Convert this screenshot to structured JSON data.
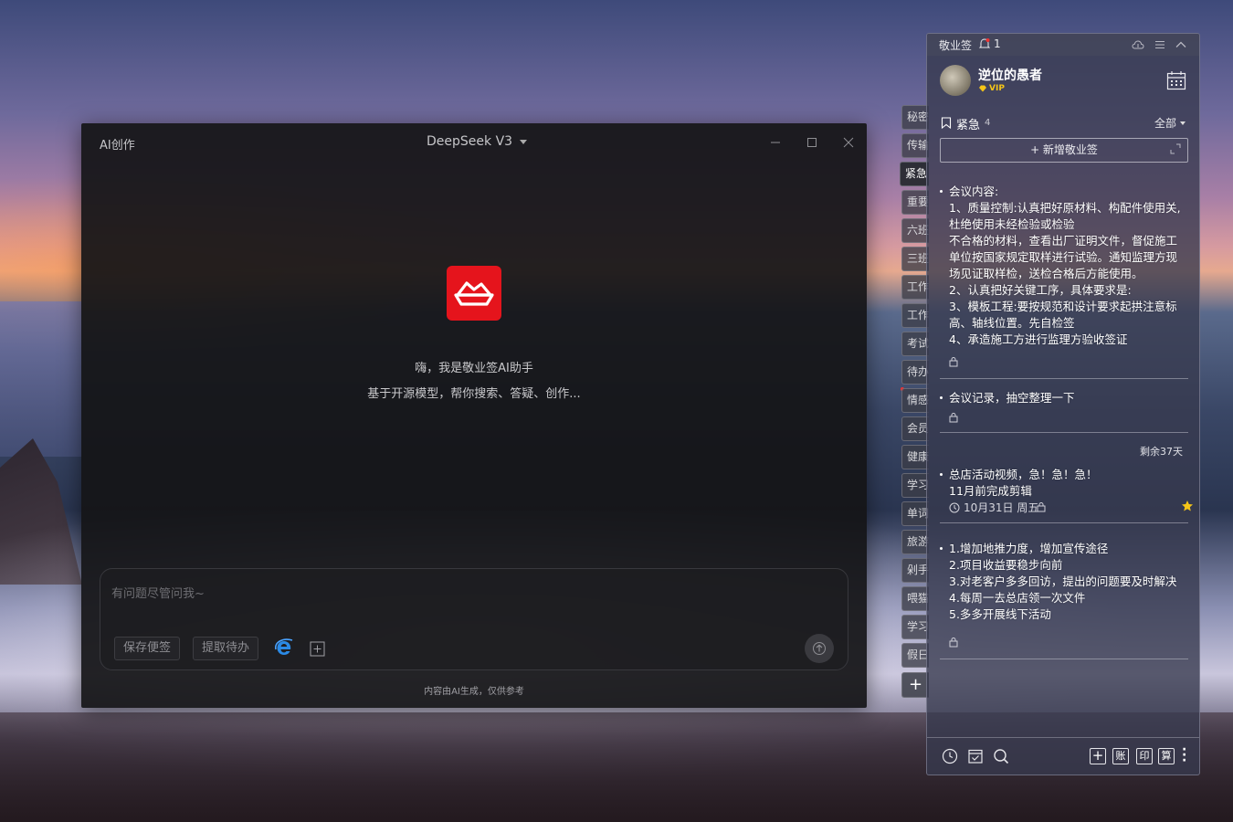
{
  "ai_window": {
    "title": "AI创作",
    "model": "DeepSeek V3",
    "greeting_line1": "嗨，我是敬业签AI助手",
    "greeting_line2": "基于开源模型，帮你搜索、答疑、创作...",
    "input_placeholder": "有问题尽管问我~",
    "save_note_label": "保存便签",
    "extract_todo_label": "提取待办",
    "disclaimer": "内容由AI生成，仅供参考",
    "brand_color": "#e5141c"
  },
  "category_tabs": [
    {
      "label": "秘密"
    },
    {
      "label": "传输"
    },
    {
      "label": "紧急",
      "active": true
    },
    {
      "label": "重要"
    },
    {
      "label": "六班"
    },
    {
      "label": "三班"
    },
    {
      "label": "工作"
    },
    {
      "label": "工作"
    },
    {
      "label": "考试"
    },
    {
      "label": "待办"
    },
    {
      "label": "情感"
    },
    {
      "label": "会员"
    },
    {
      "label": "健康"
    },
    {
      "label": "学习"
    },
    {
      "label": "单词"
    },
    {
      "label": "旅游"
    },
    {
      "label": "剁手"
    },
    {
      "label": "喂猫"
    },
    {
      "label": "学习"
    },
    {
      "label": "假日"
    }
  ],
  "notes_panel": {
    "app_name": "敬业签",
    "notification_count": "1",
    "user_name": "逆位的愚者",
    "vip_label": "VIP",
    "category": "紧急",
    "category_count": "4",
    "filter": "全部",
    "new_note_label": "+ 新增敬业签",
    "remaining": "剩余37天",
    "notes": [
      {
        "text": "会议内容:\n1、质量控制:认真把好原材料、构配件使用关,杜绝使用未经检验或检验\n不合格的材料，查看出厂证明文件，督促施工单位按国家规定取样进行试验。通知监理方现场见证取样检，送检合格后方能使用。\n2、认真把好关键工序，具体要求是:\n3、模板工程:要按规范和设计要求起拱注意标高、轴线位置。先自检签\n4、承造施工方进行监理方验收签证"
      },
      {
        "text": "会议记录，抽空整理一下"
      },
      {
        "text": "总店活动视频，急！急！急！\n11月前完成剪辑",
        "date": "10月31日 周五"
      },
      {
        "text": "1.增加地推力度，增加宣传途径\n2.项目收益要稳步向前\n3.对老客户多多回访，提出的问题要及时解决\n4.每周一去总店领一次文件\n5.多多开展线下活动"
      }
    ],
    "footer": {
      "add_label": "+",
      "account_label": "账",
      "print_label": "印",
      "calc_label": "算"
    }
  }
}
